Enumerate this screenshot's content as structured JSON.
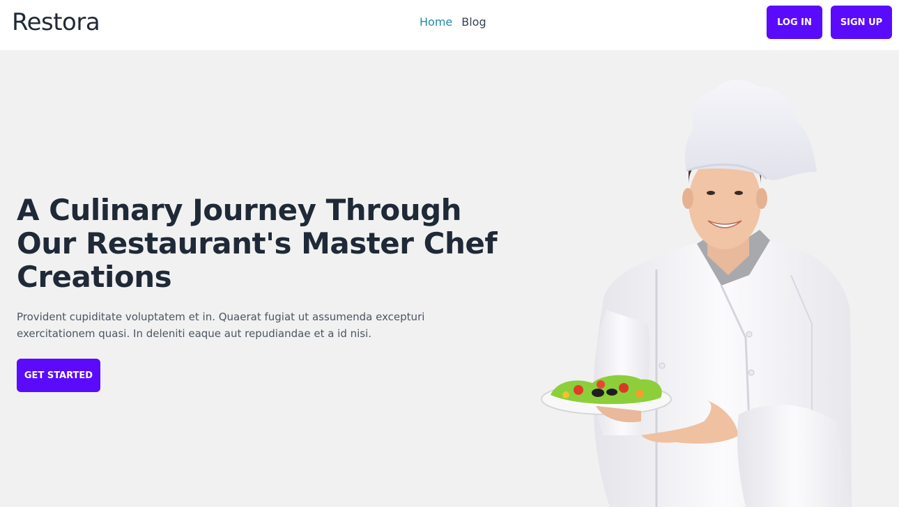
{
  "navbar": {
    "brand": "Restora",
    "links": [
      {
        "label": "Home",
        "active": true
      },
      {
        "label": "Blog",
        "active": false
      }
    ],
    "login_label": "LOG IN",
    "signup_label": "SIGN UP"
  },
  "hero": {
    "title": "A Culinary Journey Through Our Restaurant's Master Chef Creations",
    "description": "Provident cupiditate voluptatem et in. Quaerat fugiat ut assumenda excepturi exercitationem quasi. In deleniti eaque aut repudiandae et a id nisi.",
    "cta_label": "GET STARTED",
    "image": "chef-holding-salad-plate"
  },
  "colors": {
    "accent": "#5b0bfb",
    "active_link": "#1e8ea3",
    "hero_bg": "#f1f1f1",
    "heading": "#1f2937"
  }
}
